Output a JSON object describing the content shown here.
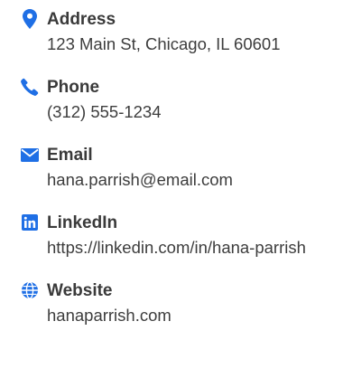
{
  "theme": {
    "accent": "#1f6fe5",
    "label_color": "#3a3a3a",
    "value_color": "#3d3d3d"
  },
  "contacts": [
    {
      "icon": "location-pin-icon",
      "label": "Address",
      "value": "123 Main St, Chicago, IL 60601"
    },
    {
      "icon": "phone-icon",
      "label": "Phone",
      "value": "(312) 555-1234"
    },
    {
      "icon": "envelope-icon",
      "label": "Email",
      "value": "hana.parrish@email.com"
    },
    {
      "icon": "linkedin-icon",
      "label": "LinkedIn",
      "value": "https://linkedin.com/in/hana-parrish"
    },
    {
      "icon": "globe-icon",
      "label": "Website",
      "value": "hanaparrish.com"
    }
  ]
}
